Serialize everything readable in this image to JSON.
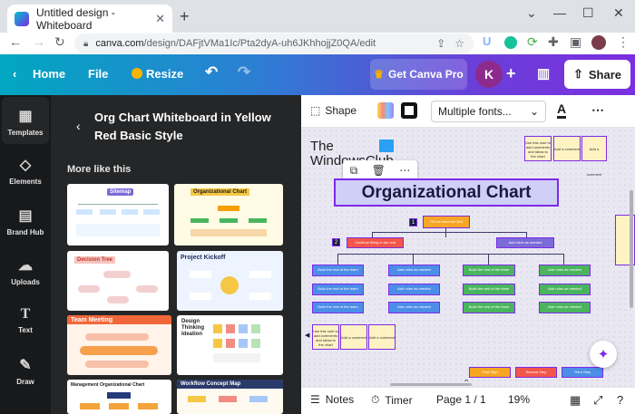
{
  "browser": {
    "tab_title": "Untitled design - Whiteboard",
    "url_host": "canva.com",
    "url_path": "/design/DAFjtVMa1Ic/Pta2dyA-uh6JKhhojjZ0QA/edit"
  },
  "topbar": {
    "home": "Home",
    "file": "File",
    "resize": "Resize",
    "get_pro": "Get Canva Pro",
    "avatar_initial": "K",
    "share": "Share"
  },
  "rail": [
    {
      "label": "Templates",
      "icon": "templates-icon"
    },
    {
      "label": "Elements",
      "icon": "elements-icon"
    },
    {
      "label": "Brand Hub",
      "icon": "brand-hub-icon"
    },
    {
      "label": "Uploads",
      "icon": "uploads-icon"
    },
    {
      "label": "Text",
      "icon": "text-icon"
    },
    {
      "label": "Draw",
      "icon": "draw-icon"
    }
  ],
  "panel": {
    "title": "Org Chart Whiteboard in Yellow Red Basic Style",
    "more_like_this": "More like this",
    "thumbs": [
      {
        "label": "Sitemap"
      },
      {
        "label": "Organizational Chart"
      },
      {
        "label": "Decision Tree"
      },
      {
        "label": "Project Kickoff"
      },
      {
        "label": "Team Meeting"
      },
      {
        "label": "Design Thinking Ideation"
      },
      {
        "label": "Management Organizational Chart"
      },
      {
        "label": "Workflow Concept Map"
      }
    ]
  },
  "editor_toolbar": {
    "shape": "Shape",
    "font": "Multiple fonts..."
  },
  "canvas": {
    "watermark_line1": "The",
    "watermark_line2": "WindowsClub",
    "heading": "Organizational Chart",
    "top_box": "Fill the lead role first",
    "level2_left": "Continue filling in the rest",
    "level2_right": "Add roles as needed",
    "badge1": "1",
    "badge2": "2",
    "build_label": "Build the rest of the team",
    "add_label": "Add roles as needed",
    "note_label": "Add a comment",
    "note_text": "Use this note to add comments and ideas to the chart",
    "bottom_first": "First Step",
    "bottom_second": "Second Step",
    "bottom_third": "Third Step"
  },
  "bottombar": {
    "notes": "Notes",
    "timer": "Timer",
    "page": "Page 1 / 1",
    "zoom": "19%"
  }
}
